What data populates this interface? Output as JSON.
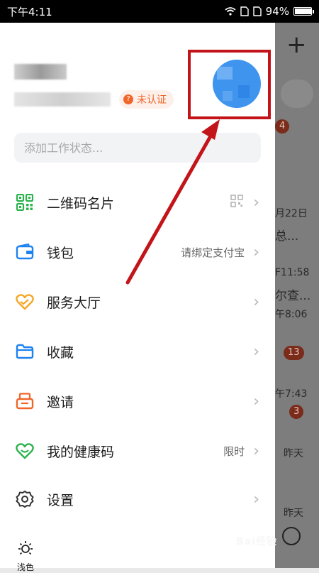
{
  "status_bar": {
    "time": "下午4:11",
    "battery": "94%",
    "battery_level": 0.94
  },
  "profile": {
    "certification": "未认证"
  },
  "status_input": {
    "placeholder": "添加工作状态..."
  },
  "menu": [
    {
      "label": "二维码名片",
      "icon": "qrcode-icon",
      "color": "#2bb24c",
      "value": ""
    },
    {
      "label": "钱包",
      "icon": "wallet-icon",
      "color": "#1e82f0",
      "value": "请绑定支付宝"
    },
    {
      "label": "服务大厅",
      "icon": "heart-hands-icon",
      "color": "#f5a623",
      "value": ""
    },
    {
      "label": "收藏",
      "icon": "folder-icon",
      "color": "#1e82f0",
      "value": ""
    },
    {
      "label": "邀请",
      "icon": "invite-icon",
      "color": "#f0652a",
      "value": ""
    },
    {
      "label": "我的健康码",
      "icon": "health-code-icon",
      "color": "#2bb24c",
      "value": "限时"
    },
    {
      "label": "设置",
      "icon": "gear-icon",
      "color": "#333333",
      "value": ""
    }
  ],
  "theme": {
    "label": "浅色"
  },
  "background": {
    "badge1": "4",
    "date1": "月22日",
    "text1": "总...",
    "time2": "F11:58",
    "text2": "尔查...",
    "time3": "午8:06",
    "badge3": "13",
    "time4": "午7:43",
    "badge4": "3",
    "day5": "昨天",
    "day6": "昨天"
  },
  "watermark": "Bai经验",
  "colors": {
    "accent_red": "#c3141a",
    "brand_blue": "#1e82f0",
    "cert_orange": "#f0652a"
  }
}
